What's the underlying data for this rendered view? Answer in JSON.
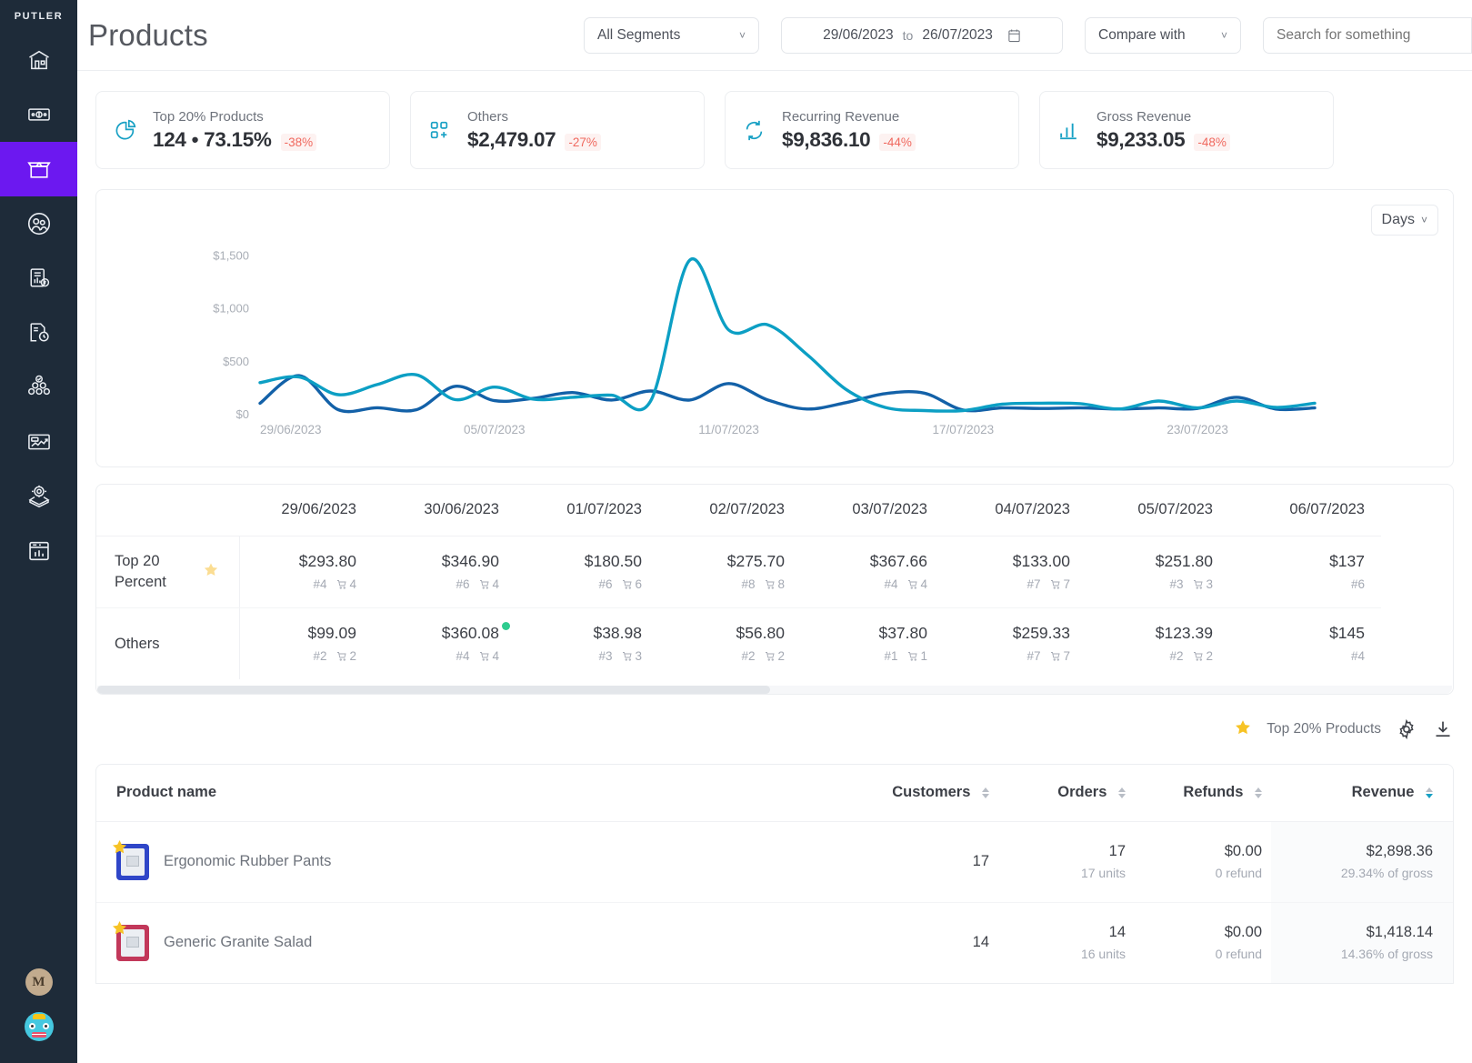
{
  "brand": "PUTLER",
  "sidebar": {
    "items": [
      {
        "name": "home",
        "icon": "store-icon"
      },
      {
        "name": "sales",
        "icon": "money-icon"
      },
      {
        "name": "products",
        "icon": "box-icon",
        "active": true
      },
      {
        "name": "customers",
        "icon": "people-icon"
      },
      {
        "name": "transactions",
        "icon": "clipboard-dollar-icon"
      },
      {
        "name": "subscriptions",
        "icon": "document-refresh-icon"
      },
      {
        "name": "audience",
        "icon": "audience-check-icon"
      },
      {
        "name": "insights",
        "icon": "chart-window-icon"
      },
      {
        "name": "goals",
        "icon": "target-box-icon"
      },
      {
        "name": "reports",
        "icon": "report-bar-icon"
      }
    ],
    "avatar_initial": "M",
    "profile_icon": "avatar-face-icon"
  },
  "header": {
    "title": "Products",
    "segments_value": "All Segments",
    "date_from": "29/06/2023",
    "date_to_word": "to",
    "date_to": "26/07/2023",
    "compare_value": "Compare with",
    "search_placeholder": "Search for something"
  },
  "stats": [
    {
      "label": "Top 20% Products",
      "value": "124 • 73.15%",
      "delta": "-38%",
      "icon": "pie-chart-icon"
    },
    {
      "label": "Others",
      "value": "$2,479.07",
      "delta": "-27%",
      "icon": "grid-plus-icon"
    },
    {
      "label": "Recurring Revenue",
      "value": "$9,836.10",
      "delta": "-44%",
      "icon": "recurring-icon"
    },
    {
      "label": "Gross Revenue",
      "value": "$9,233.05",
      "delta": "-48%",
      "icon": "bar-chart-icon"
    }
  ],
  "chart_data": {
    "type": "line",
    "title": "",
    "xlabel": "",
    "ylabel": "",
    "ylim": [
      0,
      1700
    ],
    "grid": false,
    "legend": "none",
    "ytick_labels": [
      "$0",
      "$500",
      "$1,000",
      "$1,500"
    ],
    "ytick_values": [
      0,
      500,
      1000,
      1500
    ],
    "xtick_labels": [
      "29/06/2023",
      "05/07/2023",
      "11/07/2023",
      "17/07/2023",
      "23/07/2023"
    ],
    "xtick_indices": [
      0,
      6,
      12,
      18,
      24
    ],
    "x": [
      "29/06/2023",
      "30/06/2023",
      "01/07/2023",
      "02/07/2023",
      "03/07/2023",
      "04/07/2023",
      "05/07/2023",
      "06/07/2023",
      "07/07/2023",
      "08/07/2023",
      "09/07/2023",
      "10/07/2023",
      "11/07/2023",
      "12/07/2023",
      "13/07/2023",
      "14/07/2023",
      "15/07/2023",
      "16/07/2023",
      "17/07/2023",
      "18/07/2023",
      "19/07/2023",
      "20/07/2023",
      "21/07/2023",
      "22/07/2023",
      "23/07/2023",
      "24/07/2023",
      "25/07/2023",
      "26/07/2023"
    ],
    "series": [
      {
        "name": "Top 20 Percent",
        "color": "#0c9fc4",
        "values": [
          293.8,
          346.9,
          180.5,
          275.7,
          367.66,
          133.0,
          251.8,
          137.0,
          155.0,
          175.0,
          120.0,
          1450.0,
          790.0,
          840.0,
          560.0,
          230.0,
          60.0,
          30.0,
          30.0,
          90.0,
          100.0,
          95.0,
          45.0,
          120.0,
          55.0,
          120.0,
          60.0,
          100.0
        ]
      },
      {
        "name": "Others",
        "color": "#1361a8",
        "values": [
          99.09,
          360.08,
          38.98,
          56.8,
          37.8,
          259.33,
          123.39,
          145.0,
          200.0,
          130.0,
          215.0,
          130.0,
          285.0,
          130.0,
          45.0,
          105.0,
          190.0,
          195.0,
          35.0,
          55.0,
          50.0,
          55.0,
          45.0,
          55.0,
          50.0,
          155.0,
          45.0,
          55.0
        ]
      }
    ]
  },
  "granularity": {
    "label": "Days"
  },
  "matrix": {
    "columns": [
      "29/06/2023",
      "30/06/2023",
      "01/07/2023",
      "02/07/2023",
      "03/07/2023",
      "04/07/2023",
      "05/07/2023",
      "06/07/2023"
    ],
    "rows": [
      {
        "label": "Top 20 Percent",
        "starred": true,
        "cells": [
          {
            "amount": "$293.80",
            "hash": "#4",
            "cart": "4"
          },
          {
            "amount": "$346.90",
            "hash": "#6",
            "cart": "4"
          },
          {
            "amount": "$180.50",
            "hash": "#6",
            "cart": "6"
          },
          {
            "amount": "$275.70",
            "hash": "#8",
            "cart": "8"
          },
          {
            "amount": "$367.66",
            "hash": "#4",
            "cart": "4"
          },
          {
            "amount": "$133.00",
            "hash": "#7",
            "cart": "7"
          },
          {
            "amount": "$251.80",
            "hash": "#3",
            "cart": "3"
          },
          {
            "amount": "$137",
            "hash": "#6",
            "cart": ""
          }
        ]
      },
      {
        "label": "Others",
        "starred": false,
        "cells": [
          {
            "amount": "$99.09",
            "hash": "#2",
            "cart": "2"
          },
          {
            "amount": "$360.08",
            "hash": "#4",
            "cart": "4",
            "dot": true
          },
          {
            "amount": "$38.98",
            "hash": "#3",
            "cart": "3"
          },
          {
            "amount": "$56.80",
            "hash": "#2",
            "cart": "2"
          },
          {
            "amount": "$37.80",
            "hash": "#1",
            "cart": "1"
          },
          {
            "amount": "$259.33",
            "hash": "#7",
            "cart": "7"
          },
          {
            "amount": "$123.39",
            "hash": "#2",
            "cart": "2"
          },
          {
            "amount": "$145",
            "hash": "#4",
            "cart": ""
          }
        ]
      }
    ]
  },
  "list_toolbar": {
    "top_label": "Top 20% Products",
    "star_icon": "star-icon",
    "settings_icon": "gear-icon",
    "download_icon": "download-icon"
  },
  "products_table": {
    "headers": {
      "name": "Product name",
      "customers": "Customers",
      "orders": "Orders",
      "refunds": "Refunds",
      "revenue": "Revenue"
    },
    "rows": [
      {
        "name": "Ergonomic Rubber Pants",
        "starred": true,
        "thumb_color": "#2f46c8",
        "customers": "17",
        "orders": "17",
        "orders_sub": "17 units",
        "refunds": "$0.00",
        "refunds_sub": "0 refund",
        "revenue": "$2,898.36",
        "revenue_sub": "29.34% of gross"
      },
      {
        "name": "Generic Granite Salad",
        "starred": true,
        "thumb_color": "#c2385a",
        "customers": "14",
        "orders": "14",
        "orders_sub": "16 units",
        "refunds": "$0.00",
        "refunds_sub": "0 refund",
        "revenue": "$1,418.14",
        "revenue_sub": "14.36% of gross"
      }
    ]
  },
  "colors": {
    "sidebar_bg": "#1e2b39",
    "active_nav": "#6c18f0",
    "accent_teal": "#17a0c4",
    "line_primary": "#0c9fc4",
    "line_secondary": "#1361a8",
    "negative": "#f0695f",
    "star": "#f7c325"
  }
}
